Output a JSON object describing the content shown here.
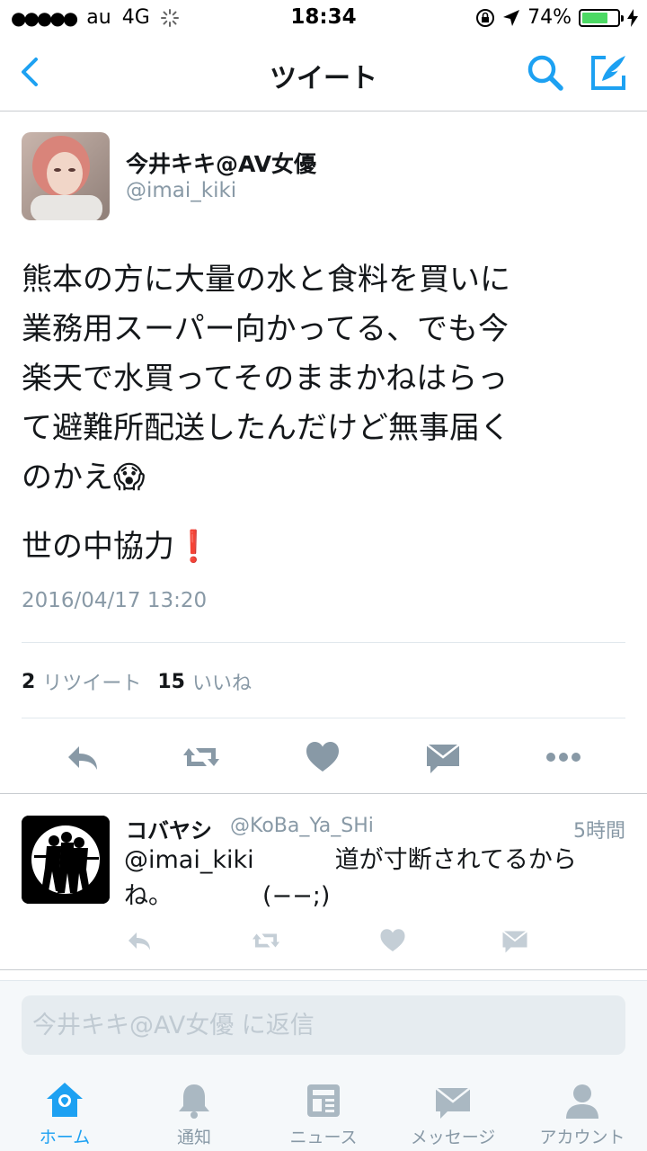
{
  "status_bar": {
    "carrier": "au",
    "network": "4G",
    "time": "18:34",
    "battery": "74%",
    "battery_level": 0.74
  },
  "nav": {
    "title": "ツイート",
    "icons": [
      "back-icon",
      "search-icon",
      "compose-icon"
    ],
    "accent_color": "#1da1f2"
  },
  "tweet": {
    "display_name": "今井キキ@AV女優",
    "handle": "@imai_kiki",
    "text_lines": [
      "熊本の方に大量の水と食料を買いに",
      "業務用スーパー向かってる、でも今",
      "楽天で水買ってそのままかねはらっ",
      "て避難所配送したんだけど無事届く",
      "のかえ😱"
    ],
    "text_second": "世の中協力❗️",
    "timestamp": "2016/04/17 13:20",
    "retweet_count": "2",
    "retweet_label": "リツイート",
    "like_count": "15",
    "like_label": "いいね",
    "actions": [
      "reply-icon",
      "retweet-icon",
      "like-icon",
      "message-icon",
      "more-icon"
    ]
  },
  "reply": {
    "display_name": "コバヤシ",
    "handle": "@KoBa_Ya_SHi",
    "time": "5時間",
    "mention": "@imai_kiki",
    "text_part1": "道が寸断されてるから",
    "text_part2": "ね。",
    "text_part3": "(−−;)"
  },
  "reply_box": {
    "placeholder": "今井キキ@AV女優 に返信"
  },
  "tabbar": {
    "items": [
      {
        "label": "ホーム",
        "icon": "home-icon",
        "active": true
      },
      {
        "label": "通知",
        "icon": "bell-icon",
        "active": false
      },
      {
        "label": "ニュース",
        "icon": "news-icon",
        "active": false
      },
      {
        "label": "メッセージ",
        "icon": "envelope-icon",
        "active": false
      },
      {
        "label": "アカウント",
        "icon": "person-icon",
        "active": false
      }
    ]
  }
}
